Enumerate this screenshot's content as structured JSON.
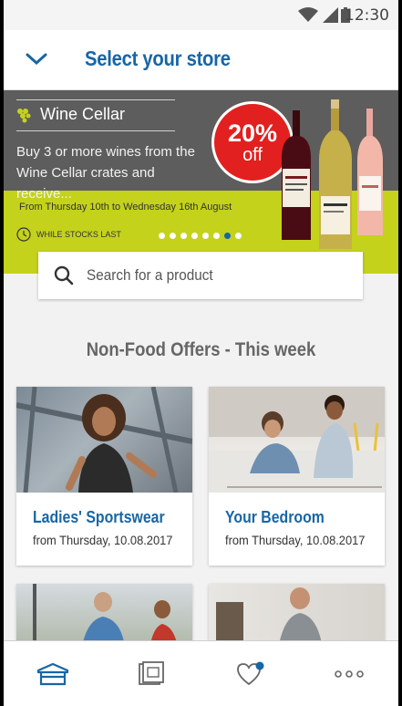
{
  "status_bar": {
    "time": "12:30"
  },
  "header": {
    "title": "Select your store"
  },
  "banner": {
    "brand": "Wine Cellar",
    "promo_line1": "Buy 3 or more wines from the",
    "promo_line2": "Wine Cellar crates and receive...",
    "badge_percent": "20%",
    "badge_off": "off",
    "dates": "From Thursday 10th to Wednesday 16th August",
    "stock_note": "WHILE STOCKS LAST",
    "carousel_total": 8,
    "carousel_active": 7,
    "colors": {
      "dark": "#5d5d5d",
      "lime": "#c4d21c",
      "badge": "#e2201f"
    }
  },
  "search": {
    "placeholder": "Search for a product"
  },
  "section": {
    "title": "Non-Food Offers - This week"
  },
  "offers": [
    {
      "title": "Ladies' Sportswear",
      "subtitle": "from Thursday, 10.08.2017"
    },
    {
      "title": "Your Bedroom",
      "subtitle": "from Thursday, 10.08.2017"
    }
  ],
  "bottom_nav": {
    "items": [
      {
        "icon": "store-icon"
      },
      {
        "icon": "leaflet-icon"
      },
      {
        "icon": "heart-icon"
      },
      {
        "icon": "more-icon"
      }
    ]
  },
  "colors": {
    "accent": "#1766a6",
    "notify": "#1766a6"
  }
}
